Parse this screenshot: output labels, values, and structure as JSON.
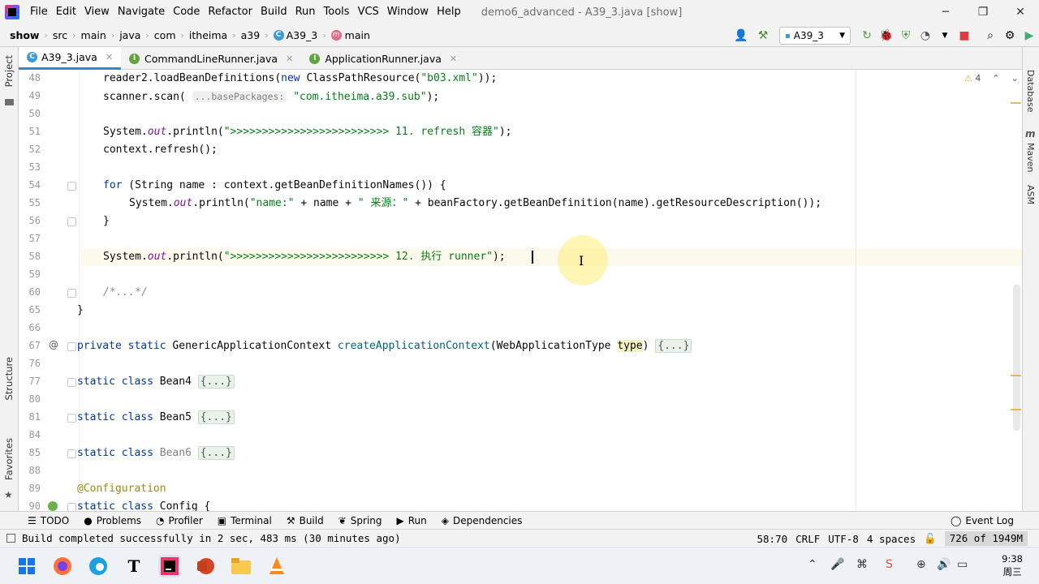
{
  "window": {
    "title": "demo6_advanced - A39_3.java [show]",
    "menu": [
      "File",
      "Edit",
      "View",
      "Navigate",
      "Code",
      "Refactor",
      "Build",
      "Run",
      "Tools",
      "VCS",
      "Window",
      "Help"
    ],
    "controls": {
      "minimize": "─",
      "maximize": "❐",
      "close": "✕"
    }
  },
  "breadcrumb": {
    "items": [
      "show",
      "src",
      "main",
      "java",
      "com",
      "itheima",
      "a39",
      "A39_3",
      "main"
    ],
    "separator": "›"
  },
  "run_config": {
    "label": "A39_3"
  },
  "tabs": [
    {
      "label": "A39_3.java",
      "icon": "class-icon",
      "active": true
    },
    {
      "label": "CommandLineRunner.java",
      "icon": "interface-icon",
      "active": false
    },
    {
      "label": "ApplicationRunner.java",
      "icon": "interface-icon",
      "active": false
    }
  ],
  "left_strip": {
    "project": "Project",
    "structure": "Structure",
    "favorites": "Favorites"
  },
  "right_strip": {
    "database": "Database",
    "maven": "Maven",
    "asm": "ASM"
  },
  "inspection": {
    "warnings": "4"
  },
  "code_lines": [
    {
      "n": "48",
      "text": "reader2.loadBeanDefinitions(new ClassPathResource(\"b03.xml\"));"
    },
    {
      "n": "49",
      "text": "scanner.scan( ...basePackages: \"com.itheima.a39.sub\");"
    },
    {
      "n": "50",
      "text": ""
    },
    {
      "n": "51",
      "text": "System.out.println(\">>>>>>>>>>>>>>>>>>>>>>>>> 11. refresh 容器\");"
    },
    {
      "n": "52",
      "text": "context.refresh();"
    },
    {
      "n": "53",
      "text": ""
    },
    {
      "n": "54",
      "text": "for (String name : context.getBeanDefinitionNames()) {"
    },
    {
      "n": "55",
      "text": "System.out.println(\"name:\" + name + \" 来源：\" + beanFactory.getBeanDefinition(name).getResourceDescription());"
    },
    {
      "n": "56",
      "text": "}"
    },
    {
      "n": "57",
      "text": ""
    },
    {
      "n": "58",
      "text": "System.out.println(\">>>>>>>>>>>>>>>>>>>>>>>>> 12. 执行 runner\");"
    },
    {
      "n": "59",
      "text": ""
    },
    {
      "n": "60",
      "text": "/*...*/"
    },
    {
      "n": "65",
      "text": "}"
    },
    {
      "n": "66",
      "text": ""
    },
    {
      "n": "67",
      "text": "private static GenericApplicationContext createApplicationContext(WebApplicationType type) {...}"
    },
    {
      "n": "76",
      "text": ""
    },
    {
      "n": "77",
      "text": "static class Bean4 {...}"
    },
    {
      "n": "80",
      "text": ""
    },
    {
      "n": "81",
      "text": "static class Bean5 {...}"
    },
    {
      "n": "84",
      "text": ""
    },
    {
      "n": "85",
      "text": "static class Bean6 {...}"
    },
    {
      "n": "88",
      "text": ""
    },
    {
      "n": "89",
      "text": "@Configuration"
    },
    {
      "n": "90",
      "text": "static class Config {"
    }
  ],
  "tool_windows": [
    {
      "label": "TODO",
      "icon": "list-icon"
    },
    {
      "label": "Problems",
      "icon": "problems-icon"
    },
    {
      "label": "Profiler",
      "icon": "profiler-icon"
    },
    {
      "label": "Terminal",
      "icon": "terminal-icon"
    },
    {
      "label": "Build",
      "icon": "hammer-icon"
    },
    {
      "label": "Spring",
      "icon": "spring-icon"
    },
    {
      "label": "Run",
      "icon": "run-icon"
    },
    {
      "label": "Dependencies",
      "icon": "dependencies-icon"
    }
  ],
  "event_log": "Event Log",
  "status": {
    "message": "Build completed successfully in 2 sec, 483 ms (30 minutes ago)",
    "position": "58:70",
    "line_sep": "CRLF",
    "encoding": "UTF-8",
    "indent": "4 spaces",
    "memory": "726 of 1949M"
  },
  "taskbar": {
    "time": "9:38",
    "day": "周三"
  },
  "colors": {
    "accent": "#4083c9",
    "keyword": "#0033b3",
    "string": "#067d17",
    "field": "#871094"
  }
}
